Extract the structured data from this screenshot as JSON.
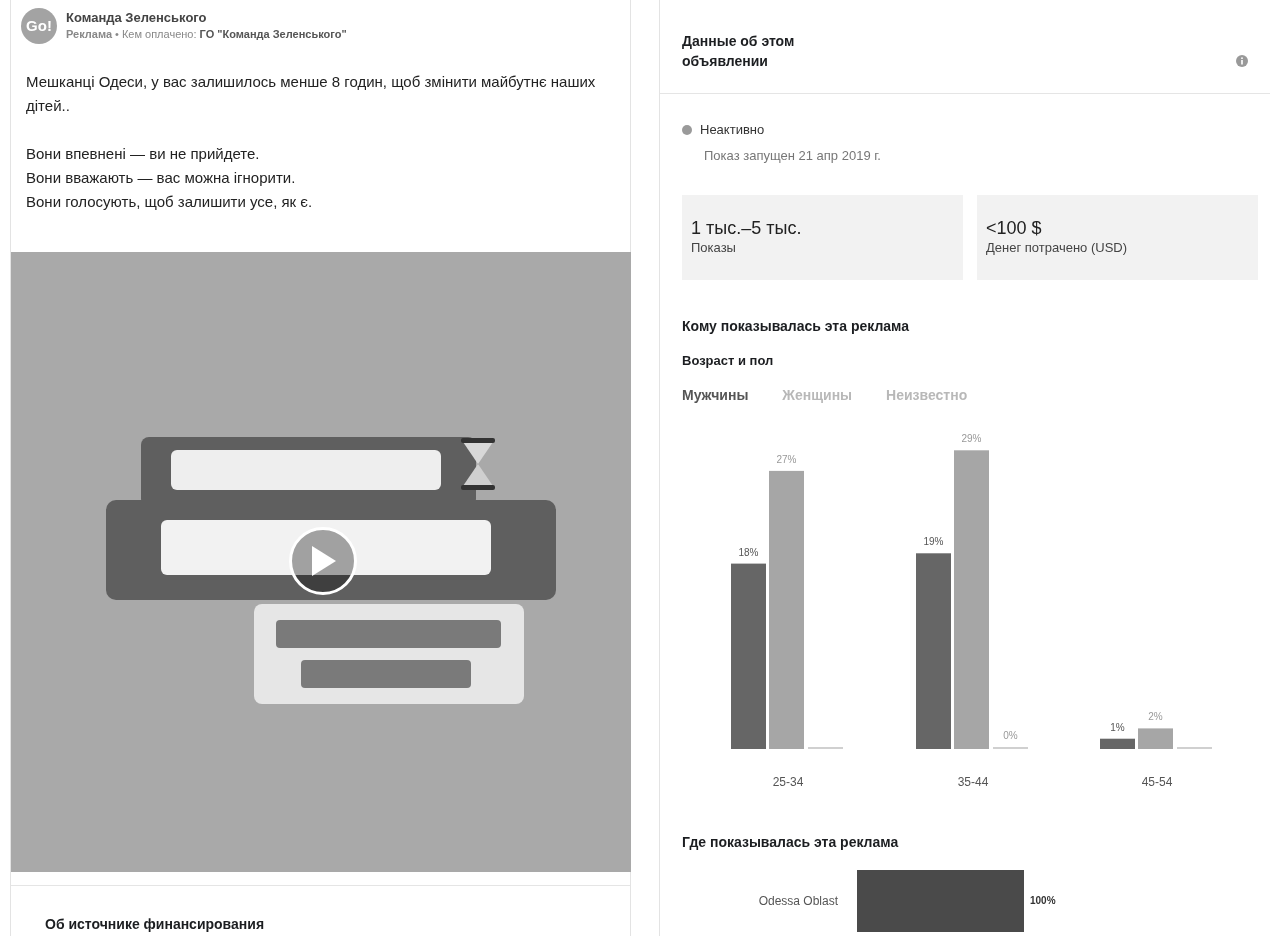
{
  "post": {
    "avatar_text": "Go!",
    "page_name": "Команда Зеленського",
    "sponsor_label": "Реклама",
    "separator": "•",
    "paid_by_label": "Кем оплачено:",
    "paid_by": "ГО \"Команда Зеленського\"",
    "paragraphs": [
      {
        "lines": [
          "Мешканці Одеси, у вас залишилось менше 8 годин, щоб змінити майбутнє наших дітей.."
        ]
      },
      {
        "lines": [
          "Вони впевнені — ви не прийдете.",
          "Вони вважають — вас можна ігнорити.",
          "Вони голосують, щоб залишити усе, як є."
        ]
      }
    ],
    "footer_heading": "Об источнике финансирования"
  },
  "details": {
    "title": "Данные об этом объявлении",
    "status": {
      "label": "Неактивно",
      "active": false,
      "started": "Показ запущен 21 апр 2019 г."
    },
    "stats": [
      {
        "value": "1 тыс.–5 тыс.",
        "label": "Показы"
      },
      {
        "value": "<100 $",
        "label": "Денег потрачено (USD)"
      }
    ],
    "audience_heading": "Кому показывалась эта реклама",
    "age_gender_heading": "Возраст и пол",
    "gender_tabs": [
      {
        "label": "Мужчины",
        "selected": true
      },
      {
        "label": "Женщины",
        "selected": false
      },
      {
        "label": "Неизвестно",
        "selected": false
      }
    ],
    "age_chart": {
      "chart_data": {
        "type": "bar",
        "categories": [
          "25-34",
          "35-44",
          "45-54"
        ],
        "series": [
          {
            "color": "#666666",
            "values": [
              18,
              19,
              1
            ],
            "value_labels": [
              "18%",
              "19%",
              "1%"
            ]
          },
          {
            "color": "#a6a6a6",
            "values": [
              27,
              29,
              2
            ],
            "value_labels": [
              "27%",
              "29%",
              "2%"
            ]
          },
          {
            "color": "#d0d0d0",
            "values": [
              0,
              0,
              0
            ],
            "value_labels": [
              null,
              "0%",
              null
            ]
          }
        ]
      }
    },
    "location_heading": "Где показывалась эта реклама",
    "locations": [
      {
        "name": "Odessa Oblast",
        "share": "100%"
      }
    ]
  }
}
